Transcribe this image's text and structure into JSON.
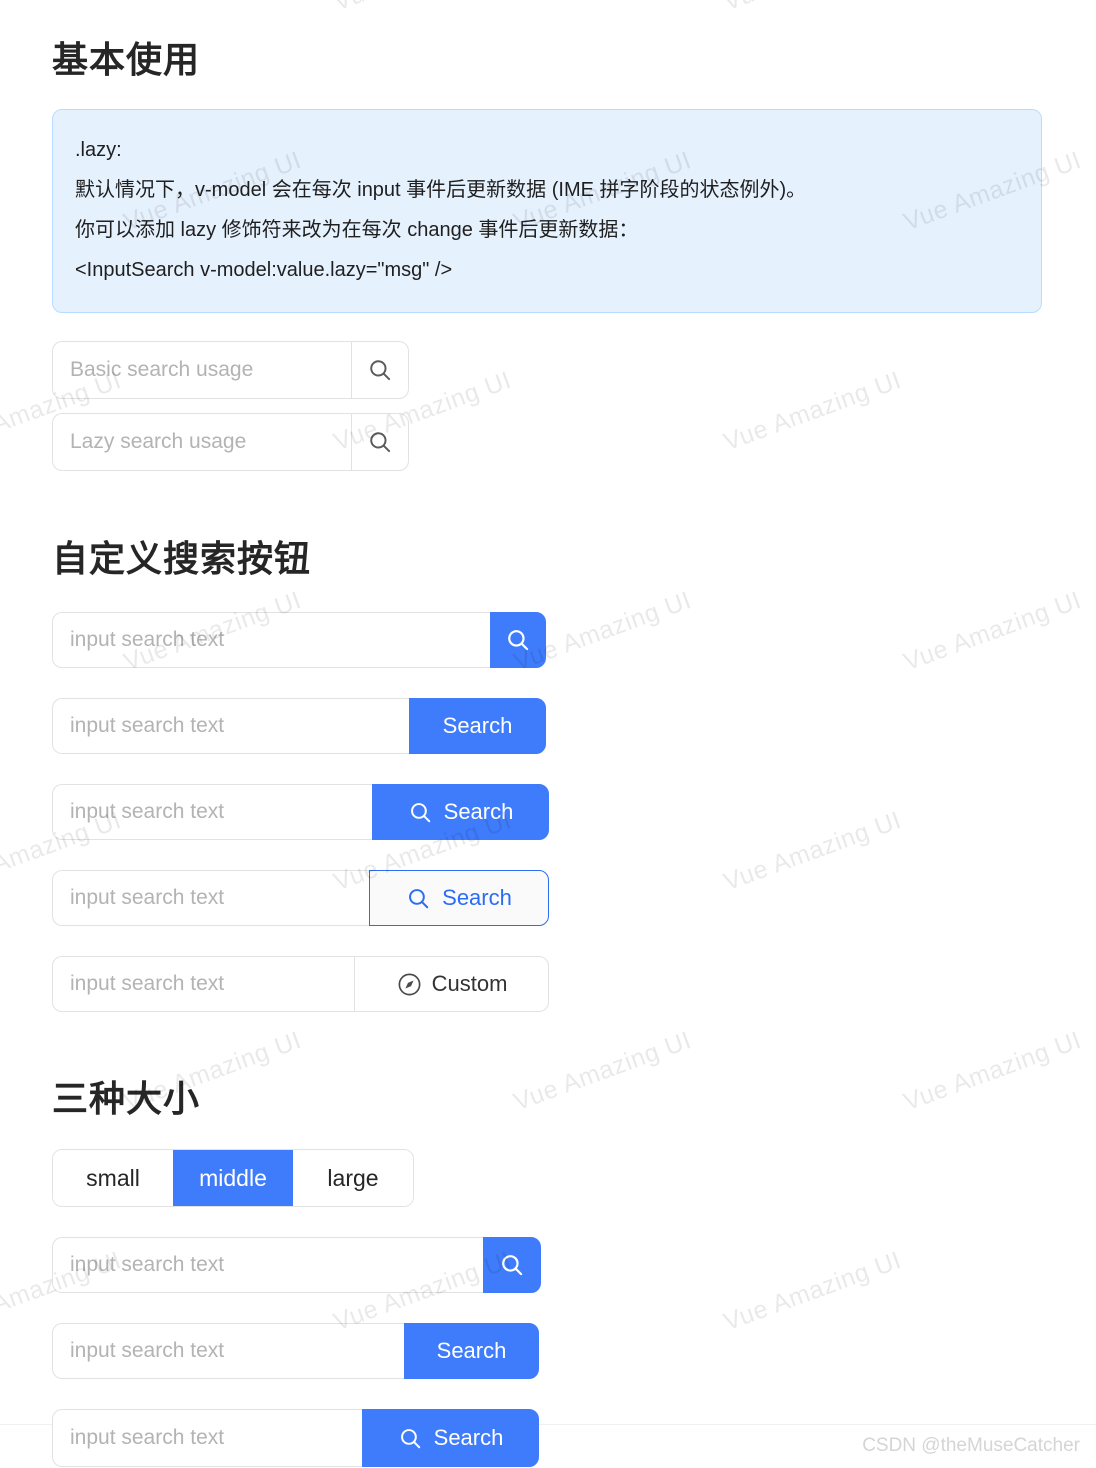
{
  "theme": {
    "primary": "#3f7cfb",
    "primary_text": "#2b6cf5",
    "alert_bg": "#e6f1fe",
    "alert_border": "#b7dcff",
    "border": "#e2e2e2",
    "placeholder": "#b3b3b3"
  },
  "watermark": {
    "text": "Vue Amazing UI",
    "csdn": "CSDN @theMuseCatcher"
  },
  "sections": {
    "basic": {
      "title": "基本使用",
      "alert": {
        "lines": [
          ".lazy:",
          "默认情况下，v-model 会在每次 input 事件后更新数据 (IME 拼字阶段的状态例外)。",
          "你可以添加 lazy 修饰符来改为在每次 change 事件后更新数据：",
          "<InputSearch v-model:value.lazy=\"msg\" />"
        ]
      },
      "inputs": [
        {
          "placeholder": "Basic search usage",
          "button": {
            "type": "icon-only",
            "icon": "search-icon",
            "style": "plain"
          }
        },
        {
          "placeholder": "Lazy search usage",
          "button": {
            "type": "icon-only",
            "icon": "search-icon",
            "style": "plain"
          }
        }
      ]
    },
    "custom": {
      "title": "自定义搜索按钮",
      "inputs": [
        {
          "placeholder": "input search text",
          "button": {
            "type": "icon-only",
            "icon": "search-icon",
            "style": "primary",
            "label": ""
          }
        },
        {
          "placeholder": "input search text",
          "button": {
            "type": "text-only",
            "icon": "",
            "style": "primary",
            "label": "Search"
          }
        },
        {
          "placeholder": "input search text",
          "button": {
            "type": "icon-text",
            "icon": "search-icon",
            "style": "primary",
            "label": "Search"
          }
        },
        {
          "placeholder": "input search text",
          "button": {
            "type": "icon-text",
            "icon": "search-icon",
            "style": "outline",
            "label": "Search"
          }
        },
        {
          "placeholder": "input search text",
          "button": {
            "type": "icon-text",
            "icon": "compass-icon",
            "style": "plain",
            "label": "Custom"
          }
        }
      ]
    },
    "sizes": {
      "title": "三种大小",
      "radio": {
        "options": [
          "small",
          "middle",
          "large"
        ],
        "selected": "middle"
      },
      "inputs": [
        {
          "placeholder": "input search text",
          "size": "small",
          "button": {
            "type": "icon-only",
            "icon": "search-icon",
            "style": "primary",
            "label": ""
          }
        },
        {
          "placeholder": "input search text",
          "size": "middle",
          "button": {
            "type": "text-only",
            "icon": "",
            "style": "primary",
            "label": "Search"
          }
        },
        {
          "placeholder": "input search text",
          "size": "large",
          "button": {
            "type": "icon-text",
            "icon": "search-icon",
            "style": "primary",
            "label": "Search"
          }
        }
      ]
    }
  }
}
